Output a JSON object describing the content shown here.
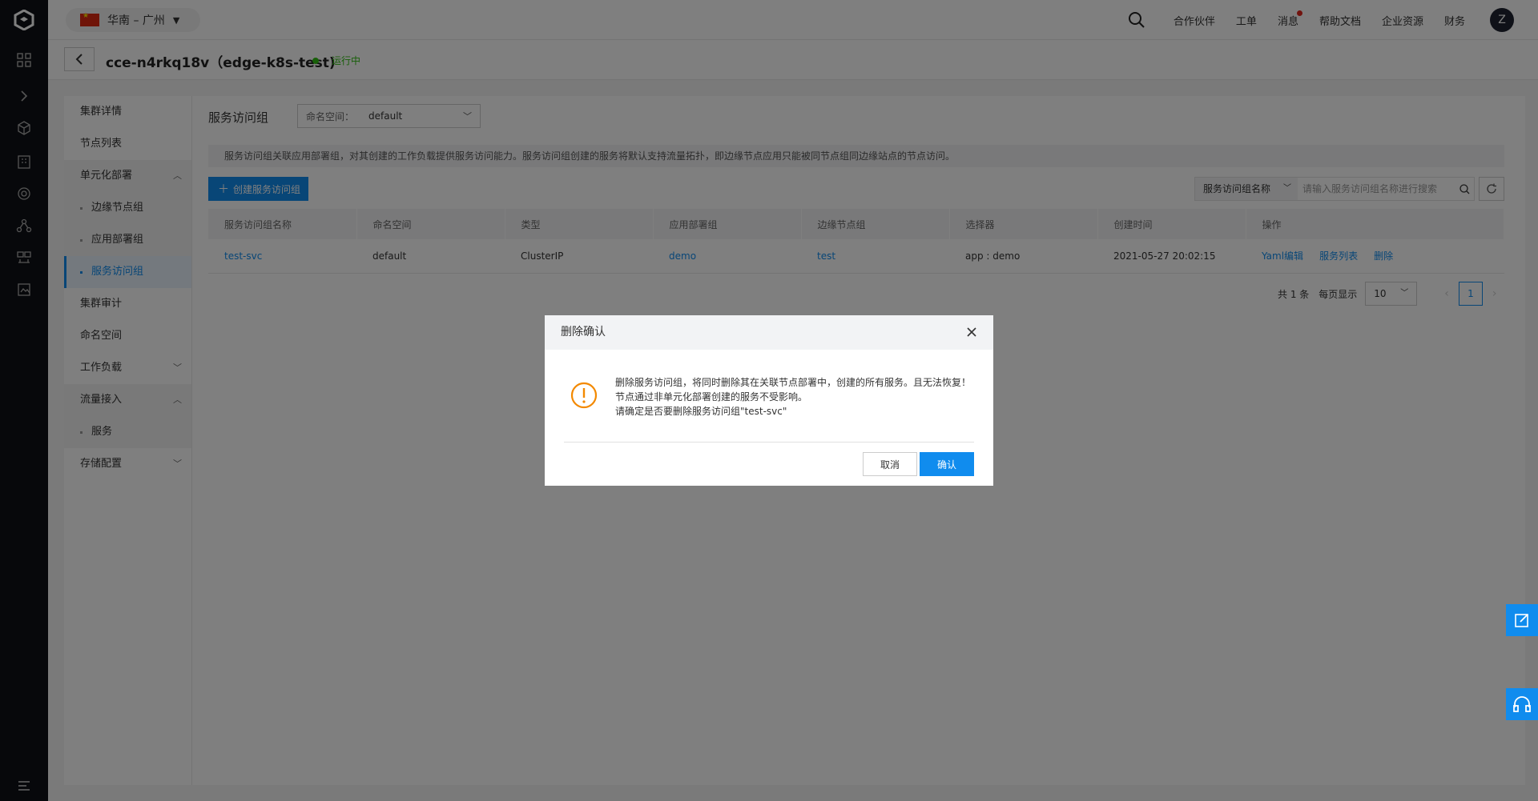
{
  "topbar": {
    "region": "华南 – 广州",
    "nav": [
      "合作伙伴",
      "工单",
      "消息",
      "帮助文档",
      "企业资源",
      "财务"
    ],
    "avatar_initial": "Z"
  },
  "header": {
    "cluster_title": "cce-n4rkq18v（edge-k8s-test)",
    "status": "运行中"
  },
  "subnav": [
    {
      "label": "集群详情"
    },
    {
      "label": "节点列表"
    },
    {
      "label": "单元化部署"
    },
    {
      "label": "边缘节点组"
    },
    {
      "label": "应用部署组"
    },
    {
      "label": "服务访问组"
    },
    {
      "label": "集群审计"
    },
    {
      "label": "命名空间"
    },
    {
      "label": "工作负载"
    },
    {
      "label": "流量接入"
    },
    {
      "label": "服务"
    },
    {
      "label": "存储配置"
    }
  ],
  "main": {
    "title": "服务访问组",
    "namespace_label": "命名空间：",
    "namespace_value": "default",
    "notice": "服务访问组关联应用部署组，对其创建的工作负载提供服务访问能力。服务访问组创建的服务将默认支持流量拓扑，即边缘节点应用只能被同节点组同边缘站点的节点访问。",
    "create_button": "创建服务访问组",
    "search_field_select": "服务访问组名称",
    "search_placeholder": "请输入服务访问组名称进行搜索"
  },
  "table": {
    "columns": [
      "服务访问组名称",
      "命名空间",
      "类型",
      "应用部署组",
      "边缘节点组",
      "选择器",
      "创建时间",
      "操作"
    ],
    "rows": [
      {
        "name": "test-svc",
        "namespace": "default",
        "type": "ClusterIP",
        "app_group": "demo",
        "edge_group": "test",
        "selector": "app : demo",
        "created": "2021-05-27 20:02:15",
        "ops": [
          "Yaml编辑",
          "服务列表",
          "删除"
        ]
      }
    ]
  },
  "pagination": {
    "total": "共 1 条",
    "per_page_label": "每页显示",
    "per_page": "10",
    "current_page": "1"
  },
  "dialog": {
    "title": "删除确认",
    "line1": "删除服务访问组，将同时删除其在关联节点部署中，创建的所有服务。且无法恢复！",
    "line2": "节点通过非单元化部署创建的服务不受影响。",
    "line3": "请确定是否要删除服务访问组\"test-svc\"",
    "cancel": "取消",
    "confirm": "确认"
  },
  "colors": {
    "accent": "#108cee",
    "running": "#30bf13",
    "warning": "#f38900",
    "rail": "#0f1116"
  }
}
